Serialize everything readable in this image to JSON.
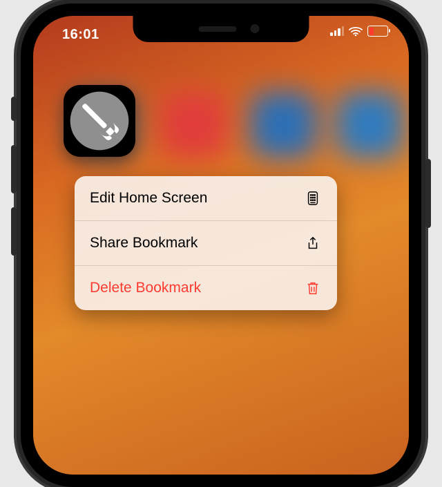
{
  "status": {
    "time": "16:01"
  },
  "focused_app": {
    "icon": "wrench-icon"
  },
  "context_menu": {
    "items": [
      {
        "label": "Edit Home Screen",
        "icon": "home-grid-icon",
        "destructive": false
      },
      {
        "label": "Share Bookmark",
        "icon": "share-icon",
        "destructive": false
      },
      {
        "label": "Delete Bookmark",
        "icon": "trash-icon",
        "destructive": true
      }
    ]
  }
}
